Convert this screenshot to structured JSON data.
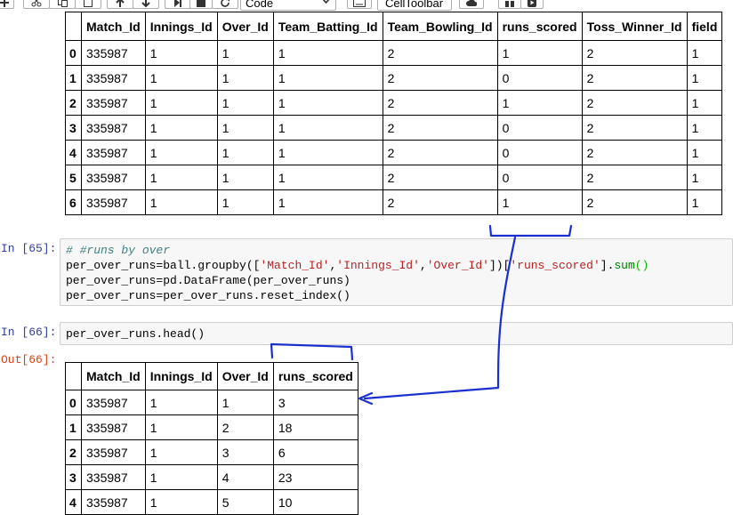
{
  "toolbar": {
    "cell_type": "Code",
    "celltoolbar_label": "CellToolbar"
  },
  "top_table": {
    "columns": [
      "Match_Id",
      "Innings_Id",
      "Over_Id",
      "Team_Batting_Id",
      "Team_Bowling_Id",
      "runs_scored",
      "Toss_Winner_Id",
      "field"
    ],
    "rows": [
      {
        "index": "0",
        "cells": [
          "335987",
          "1",
          "1",
          "1",
          "2",
          "1",
          "2",
          "1"
        ]
      },
      {
        "index": "1",
        "cells": [
          "335987",
          "1",
          "1",
          "1",
          "2",
          "0",
          "2",
          "1"
        ]
      },
      {
        "index": "2",
        "cells": [
          "335987",
          "1",
          "1",
          "1",
          "2",
          "1",
          "2",
          "1"
        ]
      },
      {
        "index": "3",
        "cells": [
          "335987",
          "1",
          "1",
          "1",
          "2",
          "0",
          "2",
          "1"
        ]
      },
      {
        "index": "4",
        "cells": [
          "335987",
          "1",
          "1",
          "1",
          "2",
          "0",
          "2",
          "1"
        ]
      },
      {
        "index": "5",
        "cells": [
          "335987",
          "1",
          "1",
          "1",
          "2",
          "0",
          "2",
          "1"
        ]
      },
      {
        "index": "6",
        "cells": [
          "335987",
          "1",
          "1",
          "1",
          "2",
          "1",
          "2",
          "1"
        ]
      }
    ]
  },
  "cell_65": {
    "prompt": "In [65]:",
    "lines": {
      "comment": "# #runs by over",
      "l2_a": "per_over_runs",
      "l2_b": "=ball.groupby([",
      "l2_s1": "'Match_Id'",
      "l2_s2": "'Innings_Id'",
      "l2_s3": "'Over_Id'",
      "l2_c": "])[",
      "l2_s4": "'runs_scored'",
      "l2_d": "].",
      "l2_fn": "sum",
      "l2_e": "()",
      "l3": "per_over_runs=pd.DataFrame(per_over_runs)",
      "l4": "per_over_runs=per_over_runs.reset_index()"
    }
  },
  "cell_66": {
    "prompt": "In [66]:",
    "code": "per_over_runs.head()",
    "out_prompt": "Out[66]:"
  },
  "bottom_table": {
    "columns": [
      "Match_Id",
      "Innings_Id",
      "Over_Id",
      "runs_scored"
    ],
    "rows": [
      {
        "index": "0",
        "cells": [
          "335987",
          "1",
          "1",
          "3"
        ]
      },
      {
        "index": "1",
        "cells": [
          "335987",
          "1",
          "2",
          "18"
        ]
      },
      {
        "index": "2",
        "cells": [
          "335987",
          "1",
          "3",
          "6"
        ]
      },
      {
        "index": "3",
        "cells": [
          "335987",
          "1",
          "4",
          "23"
        ]
      },
      {
        "index": "4",
        "cells": [
          "335987",
          "1",
          "5",
          "10"
        ]
      }
    ]
  },
  "annotation": {
    "ink_color": "#1a2fd0"
  }
}
